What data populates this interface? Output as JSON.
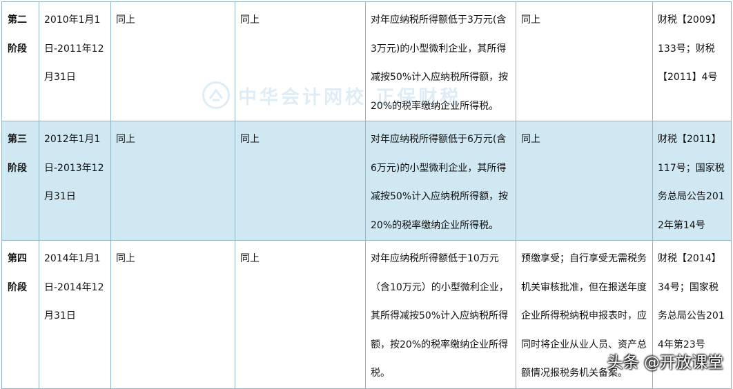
{
  "rows": [
    {
      "stage": "第二阶段",
      "period": "2010年1月1日-2011年12月31日",
      "col3": "同上",
      "col4": "同上",
      "policy": "对年应纳税所得额低于3万元(含3万元)的小型微利企业，其所得减按50%计入应纳税所得额，按20%的税率缴纳企业所得税。",
      "procedure": "同上",
      "document": "财税【2009】133号；财税【2011】4号"
    },
    {
      "stage": "第三阶段",
      "period": "2012年1月1日-2013年12月31日",
      "col3": "同上",
      "col4": "同上",
      "policy": "对年应纳税所得额低于6万元(含6万元)的小型微利企业，其所得减按50%计入应纳税所得额，按20%的税率缴纳企业所得税。",
      "procedure": "同上",
      "document": "财税【2011】117号；国家税务总局公告2012年第14号"
    },
    {
      "stage": "第四阶段",
      "period": "2014年1月1日-2014年12月31日",
      "col3": "同上",
      "col4": "同上",
      "policy": "对年应纳税所得额低于10万元（含10万元）的小型微利企业，其所得减按50%计入应纳税所得额，按20%的税率缴纳企业所得税。",
      "procedure": "预缴享受；自行享受无需税务机关审核批准，但在报送年度企业所得税纳税申报表时，应同时将企业从业人员、资产总额情况报税务机关备案。",
      "document": "财税【2014】34号；国家税务总局公告2014年第23号"
    }
  ],
  "watermark": {
    "text": "中华会计网校 正保财税",
    "icon": "logo-icon"
  },
  "source_mark": "头条 @开放课堂",
  "colors": {
    "border": "#8fb4c3",
    "shaded_row": "#cfe8f1",
    "watermark": "#1c7fc4"
  }
}
